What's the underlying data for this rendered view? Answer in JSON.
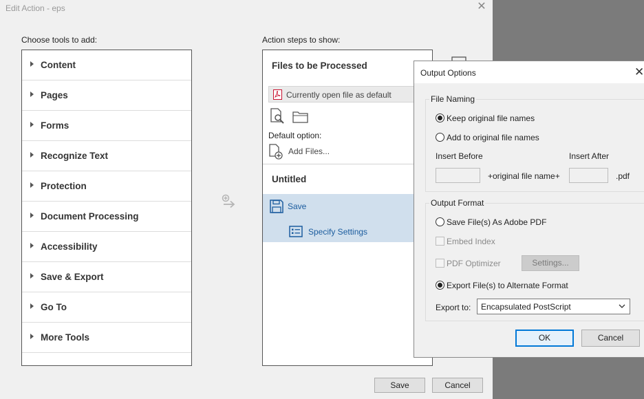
{
  "edit_action": {
    "title": "Edit Action - eps",
    "choose_label": "Choose tools to add:",
    "steps_label": "Action steps to show:",
    "tools": [
      "Content",
      "Pages",
      "Forms",
      "Recognize Text",
      "Protection",
      "Document Processing",
      "Accessibility",
      "Save & Export",
      "Go To",
      "More Tools"
    ],
    "files_heading": "Files to be Processed",
    "current_file": "Currently open file as default",
    "default_option": "Default option:",
    "add_files": "Add Files...",
    "untitled": "Untitled",
    "save_step": "Save",
    "specify_settings": "Specify Settings",
    "save_button": "Save",
    "cancel_button": "Cancel"
  },
  "output_options": {
    "title": "Output Options",
    "file_naming_label": "File Naming",
    "keep_names": "Keep original file names",
    "add_names": "Add to original file names",
    "keep_selected": true,
    "insert_before": "Insert Before",
    "insert_after": "Insert After",
    "insert_before_value": "",
    "insert_after_value": "",
    "original_name": "+original file name+",
    "ext": ".pdf",
    "output_format_label": "Output Format",
    "save_as_pdf": "Save File(s) As Adobe PDF",
    "embed_index": "Embed Index",
    "pdf_optimizer": "PDF Optimizer",
    "settings_button": "Settings...",
    "export_alt": "Export File(s) to Alternate Format",
    "export_selected": true,
    "export_to_label": "Export to:",
    "export_to_value": "Encapsulated PostScript",
    "ok_button": "OK",
    "cancel_button": "Cancel"
  },
  "colors": {
    "selection_bg": "#d0dfed",
    "link_blue": "#1b5c9e",
    "ok_border": "#0078d7",
    "pdf_red": "#c8102e"
  }
}
